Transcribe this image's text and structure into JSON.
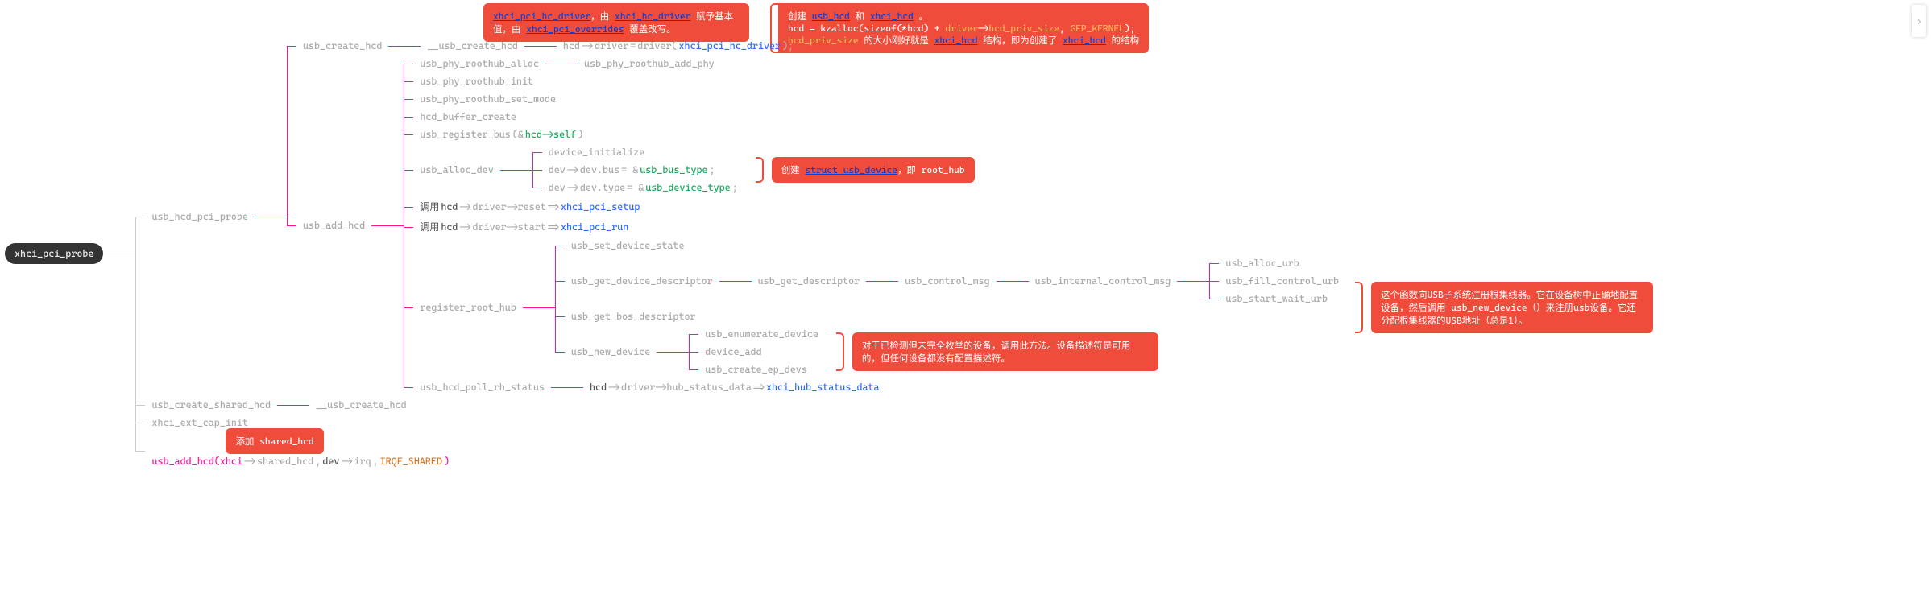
{
  "root": "xhci_pci_probe",
  "top_callouts": {
    "a": {
      "pre": "xhci_pci_hc_driver",
      "mid1": "，由 ",
      "lk1": "xhci_hc_driver",
      "mid2": " 赋予基本值，由 ",
      "lk2": "xhci_pci_overrides",
      "mid3": " 覆盖改写。"
    },
    "b": {
      "l1_pre": "创建 ",
      "l1_lk1": "usb_hcd",
      "l1_mid": " 和 ",
      "l1_lk2": "xhci_hcd",
      "l1_post": " 。",
      "l2_pre": "hcd = kzalloc(sizeof(*hcd) + ",
      "l2_o1": "driver",
      "l2_arrow": "->",
      "l2_o2": "hcd_priv_size",
      "l2_mid": ", ",
      "l2_o3": "GFP_KERNEL",
      "l2_post": ");",
      "l3_pre": "hcd_priv_size",
      "l3_mid": " 的大小刚好就是 ",
      "l3_lk1": "xhci_hcd",
      "l3_mid2": " 结构，即为创建了 ",
      "l3_lk2": "xhci_hcd",
      "l3_post": " 的结构"
    }
  },
  "nodes": {
    "usb_hcd_pci_probe": "usb_hcd_pci_probe",
    "usb_create_shared_hcd": "usb_create_shared_hcd",
    "__usb_create_shared_hcd": "__usb_create_hcd",
    "xhci_ext_cap_init": "xhci_ext_cap_init",
    "usb_add_hcd_shared": {
      "pre": "usb_add_hcd(xhci",
      "a1": "->",
      "a2": "shared_hcd",
      "mid": ", ",
      "b1": "dev",
      "b2": "->",
      "b3": "irq",
      "mid2": ", ",
      "c": "IRQF_SHARED",
      "post": ")"
    },
    "usb_create_hcd": "usb_create_hcd",
    "__usb_create_hcd": "__usb_create_hcd",
    "hcd_driver_line": {
      "p1": "hcd",
      "p2": "->",
      "p3": "driver",
      "eq": " = ",
      "p4": "driver(",
      "p5": "xhci_pci_hc_driver",
      "p6": ");"
    },
    "usb_add_hcd": "usb_add_hcd",
    "usb_phy_roothub_alloc": "usb_phy_roothub_alloc",
    "usb_phy_roothub_add_phy": "usb_phy_roothub_add_phy",
    "usb_phy_roothub_init": "usb_phy_roothub_init",
    "usb_phy_roothub_set_mode": "usb_phy_roothub_set_mode",
    "hcd_buffer_create": "hcd_buffer_create",
    "usb_register_bus": {
      "fn": "usb_register_bus",
      "arg1": "(&",
      "arg2": "hcd->self",
      "arg3": ")"
    },
    "usb_alloc_dev": "usb_alloc_dev",
    "device_initialize": "device_initialize",
    "dev_bus": {
      "p1": "dev",
      "p2": "->",
      "p3": "dev.bus",
      "eq": " = &",
      "v": "usb_bus_type",
      "sc": ";"
    },
    "dev_type": {
      "p1": "dev",
      "p2": "->",
      "p3": "dev.type",
      "eq": " = &",
      "v": "usb_device_type",
      "sc": ";"
    },
    "call_reset": {
      "p1": "调用 ",
      "p2": "hcd",
      "p3": "->",
      "p4": "driver->reset",
      "arrow": " => ",
      "fn": "xhci_pci_setup"
    },
    "call_start": {
      "p1": "调用 ",
      "p2": "hcd",
      "p3": "->",
      "p4": "driver->start",
      "arrow": " => ",
      "fn": "xhci_pci_run"
    },
    "register_root_hub": "register_root_hub",
    "usb_set_device_state": "usb_set_device_state",
    "usb_get_device_descriptor": "usb_get_device_descriptor",
    "usb_get_descriptor": "usb_get_descriptor",
    "usb_control_msg": "usb_control_msg",
    "usb_internal_control_msg": "usb_internal_control_msg",
    "usb_alloc_urb": "usb_alloc_urb",
    "usb_fill_control_urb": "usb_fill_control_urb",
    "usb_start_wait_urb": "usb_start_wait_urb",
    "usb_get_bos_descriptor": "usb_get_bos_descriptor",
    "usb_new_device": "usb_new_device",
    "usb_enumerate_device": "usb_enumerate_device",
    "device_add": "device_add",
    "usb_create_ep_devs": "usb_create_ep_devs",
    "usb_hcd_poll_rh_status": "usb_hcd_poll_rh_status",
    "poll_detail": {
      "p1": "hcd",
      "p2": "->",
      "p3": "driver->hub_status_data",
      "arrow": " => ",
      "fn": "xhci_hub_status_data"
    }
  },
  "callouts": {
    "alloc_dev": {
      "pre": "创建 ",
      "lk": "struct usb_device",
      "post": "，即 root_hub"
    },
    "new_device": "对于已检测但未完全枚举的设备，调用此方法。设备描述符是可用的，但任何设备都没有配置描述符。",
    "register_root_hub": "这个函数向USB子系统注册根集线器。它在设备树中正确地配置设备，然后调用 usb_new_device（）来注册usb设备。它还分配根集线器的USB地址（总是1）。",
    "shared_hcd": {
      "pre": "添加 ",
      "v": "shared_hcd"
    }
  },
  "collapse_btn": "›"
}
